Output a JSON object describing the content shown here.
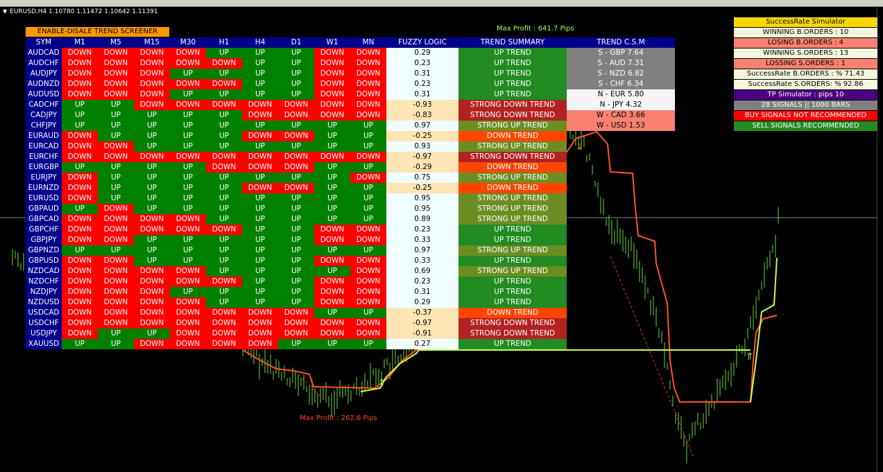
{
  "window": {
    "caption": "EURUSD,H4  1.10780 1.11472 1.10642 1.11391"
  },
  "screener_button": "ENABLE-DISALE TREND SCREENER",
  "max_profit_top": "Max Profit : 641.7 Pips",
  "max_profit_bottom": "Max Profit : 262.6 Pips",
  "table": {
    "headers": [
      "SYM",
      "M1",
      "M5",
      "M15",
      "M30",
      "H1",
      "H4",
      "D1",
      "W1",
      "MN",
      "FUZZY LOGIC",
      "TREND SUMMARY",
      "TREND C.S.M"
    ],
    "rows": [
      {
        "sym": "AUDCAD",
        "tf": [
          "DOWN",
          "DOWN",
          "DOWN",
          "DOWN",
          "UP",
          "UP",
          "UP",
          "DOWN",
          "DOWN"
        ],
        "fuzzy": "0.29",
        "summary": "UP TREND"
      },
      {
        "sym": "AUDCHF",
        "tf": [
          "DOWN",
          "DOWN",
          "DOWN",
          "DOWN",
          "DOWN",
          "UP",
          "UP",
          "DOWN",
          "DOWN"
        ],
        "fuzzy": "0.23",
        "summary": "UP TREND"
      },
      {
        "sym": "AUDJPY",
        "tf": [
          "DOWN",
          "DOWN",
          "DOWN",
          "UP",
          "UP",
          "UP",
          "UP",
          "DOWN",
          "DOWN"
        ],
        "fuzzy": "0.31",
        "summary": "UP TREND"
      },
      {
        "sym": "AUDNZD",
        "tf": [
          "DOWN",
          "DOWN",
          "DOWN",
          "DOWN",
          "DOWN",
          "UP",
          "UP",
          "DOWN",
          "DOWN"
        ],
        "fuzzy": "0.23",
        "summary": "UP TREND"
      },
      {
        "sym": "AUDUSD",
        "tf": [
          "DOWN",
          "DOWN",
          "DOWN",
          "UP",
          "UP",
          "UP",
          "UP",
          "DOWN",
          "DOWN"
        ],
        "fuzzy": "0.31",
        "summary": "UP TREND"
      },
      {
        "sym": "CADCHF",
        "tf": [
          "UP",
          "UP",
          "DOWN",
          "DOWN",
          "DOWN",
          "DOWN",
          "DOWN",
          "DOWN",
          "DOWN"
        ],
        "fuzzy": "-0.93",
        "summary": "STRONG DOWN TREND"
      },
      {
        "sym": "CADJPY",
        "tf": [
          "UP",
          "UP",
          "UP",
          "UP",
          "UP",
          "DOWN",
          "DOWN",
          "DOWN",
          "DOWN"
        ],
        "fuzzy": "-0.83",
        "summary": "STRONG DOWN TREND"
      },
      {
        "sym": "CHFJPY",
        "tf": [
          "UP",
          "UP",
          "UP",
          "UP",
          "UP",
          "UP",
          "UP",
          "UP",
          "UP"
        ],
        "fuzzy": "0.97",
        "summary": "STRONG UP TREND"
      },
      {
        "sym": "EURAUD",
        "tf": [
          "DOWN",
          "UP",
          "UP",
          "UP",
          "UP",
          "DOWN",
          "DOWN",
          "UP",
          "UP"
        ],
        "fuzzy": "-0.25",
        "summary": "DOWN TREND"
      },
      {
        "sym": "EURCAD",
        "tf": [
          "DOWN",
          "DOWN",
          "UP",
          "UP",
          "UP",
          "UP",
          "UP",
          "UP",
          "UP"
        ],
        "fuzzy": "0.93",
        "summary": "STRONG UP TREND"
      },
      {
        "sym": "EURCHF",
        "tf": [
          "DOWN",
          "DOWN",
          "DOWN",
          "DOWN",
          "DOWN",
          "DOWN",
          "DOWN",
          "DOWN",
          "DOWN"
        ],
        "fuzzy": "-0.97",
        "summary": "STRONG DOWN TREND"
      },
      {
        "sym": "EURGBP",
        "tf": [
          "UP",
          "UP",
          "UP",
          "UP",
          "DOWN",
          "DOWN",
          "DOWN",
          "UP",
          "UP"
        ],
        "fuzzy": "-0.29",
        "summary": "DOWN TREND"
      },
      {
        "sym": "EURJPY",
        "tf": [
          "DOWN",
          "UP",
          "UP",
          "UP",
          "UP",
          "UP",
          "UP",
          "UP",
          "DOWN"
        ],
        "fuzzy": "0.75",
        "summary": "STRONG UP TREND"
      },
      {
        "sym": "EURNZD",
        "tf": [
          "DOWN",
          "UP",
          "UP",
          "UP",
          "UP",
          "DOWN",
          "DOWN",
          "UP",
          "UP"
        ],
        "fuzzy": "-0.25",
        "summary": "DOWN TREND"
      },
      {
        "sym": "EURUSD",
        "tf": [
          "DOWN",
          "UP",
          "UP",
          "UP",
          "UP",
          "UP",
          "UP",
          "UP",
          "UP"
        ],
        "fuzzy": "0.95",
        "summary": "STRONG UP TREND"
      },
      {
        "sym": "GBPAUD",
        "tf": [
          "UP",
          "DOWN",
          "UP",
          "UP",
          "UP",
          "UP",
          "UP",
          "UP",
          "UP"
        ],
        "fuzzy": "0.95",
        "summary": "STRONG UP TREND"
      },
      {
        "sym": "GBPCAD",
        "tf": [
          "DOWN",
          "DOWN",
          "DOWN",
          "DOWN",
          "UP",
          "UP",
          "UP",
          "UP",
          "UP"
        ],
        "fuzzy": "0.89",
        "summary": "STRONG UP TREND"
      },
      {
        "sym": "GBPCHF",
        "tf": [
          "DOWN",
          "DOWN",
          "DOWN",
          "DOWN",
          "DOWN",
          "UP",
          "UP",
          "DOWN",
          "DOWN"
        ],
        "fuzzy": "0.23",
        "summary": "UP TREND"
      },
      {
        "sym": "GBPJPY",
        "tf": [
          "DOWN",
          "DOWN",
          "UP",
          "UP",
          "UP",
          "UP",
          "UP",
          "DOWN",
          "DOWN"
        ],
        "fuzzy": "0.33",
        "summary": "UP TREND"
      },
      {
        "sym": "GBPNZD",
        "tf": [
          "UP",
          "UP",
          "UP",
          "UP",
          "UP",
          "UP",
          "UP",
          "UP",
          "UP"
        ],
        "fuzzy": "0.97",
        "summary": "STRONG UP TREND"
      },
      {
        "sym": "GBPUSD",
        "tf": [
          "DOWN",
          "DOWN",
          "UP",
          "UP",
          "UP",
          "UP",
          "UP",
          "DOWN",
          "DOWN"
        ],
        "fuzzy": "0.33",
        "summary": "UP TREND"
      },
      {
        "sym": "NZDCAD",
        "tf": [
          "DOWN",
          "DOWN",
          "DOWN",
          "DOWN",
          "UP",
          "UP",
          "UP",
          "UP",
          "DOWN"
        ],
        "fuzzy": "0.69",
        "summary": "STRONG UP TREND"
      },
      {
        "sym": "NZDCHF",
        "tf": [
          "DOWN",
          "DOWN",
          "DOWN",
          "DOWN",
          "DOWN",
          "UP",
          "UP",
          "DOWN",
          "DOWN"
        ],
        "fuzzy": "0.23",
        "summary": "UP TREND"
      },
      {
        "sym": "NZDJPY",
        "tf": [
          "DOWN",
          "DOWN",
          "DOWN",
          "UP",
          "UP",
          "UP",
          "UP",
          "DOWN",
          "DOWN"
        ],
        "fuzzy": "0.31",
        "summary": "UP TREND"
      },
      {
        "sym": "NZDUSD",
        "tf": [
          "DOWN",
          "DOWN",
          "DOWN",
          "DOWN",
          "UP",
          "UP",
          "UP",
          "DOWN",
          "DOWN"
        ],
        "fuzzy": "0.29",
        "summary": "UP TREND"
      },
      {
        "sym": "USDCAD",
        "tf": [
          "DOWN",
          "DOWN",
          "DOWN",
          "DOWN",
          "DOWN",
          "DOWN",
          "DOWN",
          "UP",
          "UP"
        ],
        "fuzzy": "-0.37",
        "summary": "DOWN TREND"
      },
      {
        "sym": "USDCHF",
        "tf": [
          "DOWN",
          "DOWN",
          "DOWN",
          "DOWN",
          "DOWN",
          "DOWN",
          "DOWN",
          "DOWN",
          "DOWN"
        ],
        "fuzzy": "-0.97",
        "summary": "STRONG DOWN TREND"
      },
      {
        "sym": "USDJPY",
        "tf": [
          "DOWN",
          "UP",
          "UP",
          "DOWN",
          "DOWN",
          "DOWN",
          "DOWN",
          "DOWN",
          "DOWN"
        ],
        "fuzzy": "-0.91",
        "summary": "STRONG DOWN TREND"
      },
      {
        "sym": "XAUUSD",
        "tf": [
          "UP",
          "UP",
          "DOWN",
          "DOWN",
          "DOWN",
          "DOWN",
          "UP",
          "UP",
          "UP"
        ],
        "fuzzy": "0.27",
        "summary": "UP TREND"
      }
    ],
    "csm": [
      {
        "text": "S - GBP  7.64",
        "kind": "S"
      },
      {
        "text": "S - AUD  7.31",
        "kind": "S"
      },
      {
        "text": "S - NZD  6.82",
        "kind": "S"
      },
      {
        "text": "S - CHF  6.34",
        "kind": "S"
      },
      {
        "text": "N - EUR  5.80",
        "kind": "N"
      },
      {
        "text": "N - JPY  4.32",
        "kind": "N"
      },
      {
        "text": "W - CAD  3.66",
        "kind": "W"
      },
      {
        "text": "W - USD  1.53",
        "kind": "W"
      }
    ]
  },
  "simulator": [
    {
      "text": "SuccessRate Simulator",
      "style": "title"
    },
    {
      "text": "WINNING B.ORDERS : 10",
      "style": "light"
    },
    {
      "text": "LOSING B.ORDERS : 4",
      "style": "salmon"
    },
    {
      "text": "WINNING S.ORDERS : 13",
      "style": "light"
    },
    {
      "text": "LOSSING S.ORDERS : 1",
      "style": "salmon"
    },
    {
      "text": "SuccessRate B.ORDERS : % 71.43",
      "style": "light"
    },
    {
      "text": "SuccessRate S.ORDERS: % 92.86",
      "style": "light"
    },
    {
      "text": "TP Simulator : pips 10",
      "style": "purple"
    },
    {
      "text": "28 SIGNALS || 1000 BARS",
      "style": "gray"
    },
    {
      "text": "BUY SIGNALS NOT RECOMMENDED",
      "style": "red"
    },
    {
      "text": "SELL SIGNALS RECOMMENDED",
      "style": "green"
    }
  ],
  "colors": {
    "up": "#008000",
    "down": "#ff0000",
    "candle": "#66dd33",
    "stop_line": "#ff5522",
    "support_line": "#ccff44",
    "header_bg": "#00008b"
  }
}
